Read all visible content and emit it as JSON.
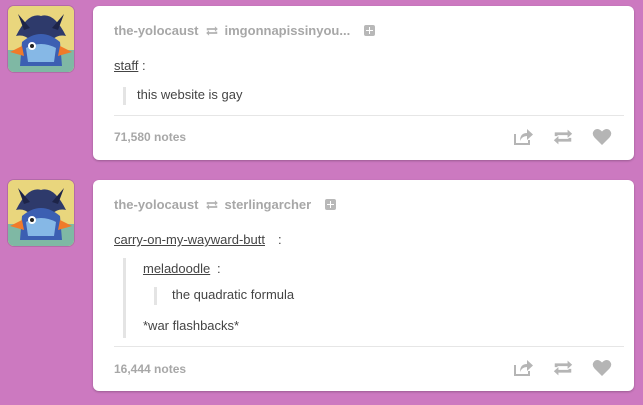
{
  "posts": [
    {
      "avatar_icon": "swampert-avatar",
      "header": {
        "user": "the-yolocaust",
        "reblog_icon": "reblog-icon",
        "source": "imgonnapissinyou..."
      },
      "username": "staff",
      "quote": "this website is gay",
      "notes": "71,580 notes",
      "actions": [
        "share-icon",
        "reblog-icon",
        "like-heart-icon"
      ]
    },
    {
      "avatar_icon": "swampert-avatar",
      "header": {
        "user": "the-yolocaust",
        "reblog_icon": "reblog-icon",
        "source": "sterlingarcher"
      },
      "username": "carry-on-my-wayward-butt",
      "nested_username": "meladoodle",
      "nested_quote": "the quadratic formula",
      "reply": "*war flashbacks*",
      "notes": "16,444 notes",
      "actions": [
        "share-icon",
        "reblog-icon",
        "like-heart-icon"
      ]
    }
  ],
  "colors": {
    "background": "#cc79c0",
    "card": "#ffffff",
    "muted_text": "#a7a7a7",
    "body_text": "#444444"
  }
}
